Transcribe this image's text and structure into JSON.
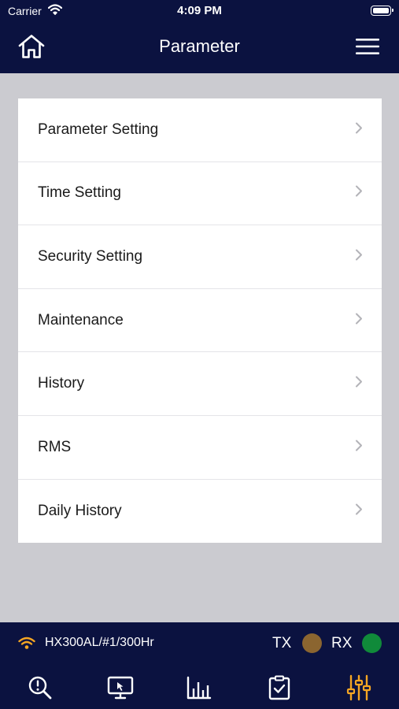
{
  "status_bar": {
    "carrier": "Carrier",
    "time": "4:09 PM"
  },
  "header": {
    "title": "Parameter"
  },
  "menu_items": [
    {
      "label": "Parameter Setting"
    },
    {
      "label": "Time Setting"
    },
    {
      "label": "Security Setting"
    },
    {
      "label": "Maintenance"
    },
    {
      "label": "History"
    },
    {
      "label": "RMS"
    },
    {
      "label": "Daily History"
    }
  ],
  "device_bar": {
    "device_name": "HX300AL/#1/300Hr",
    "tx_label": "TX",
    "tx_color": "#8b6530",
    "rx_label": "RX",
    "rx_color": "#108a3a",
    "wifi_color": "#f5a623"
  },
  "tabs": [
    {
      "icon": "search-alert-icon"
    },
    {
      "icon": "monitor-icon"
    },
    {
      "icon": "bar-chart-icon"
    },
    {
      "icon": "checklist-icon"
    },
    {
      "icon": "sliders-icon",
      "active": true
    }
  ],
  "colors": {
    "header_bg": "#0b1240",
    "active_tab": "#f5a623",
    "background": "#cbcbd0"
  }
}
